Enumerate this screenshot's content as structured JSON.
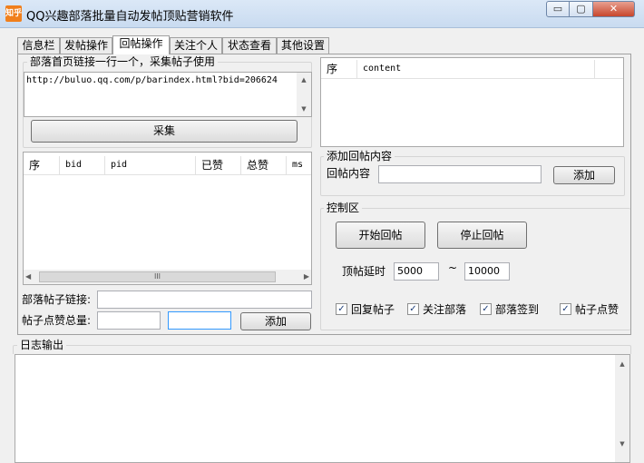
{
  "window": {
    "title": "QQ兴趣部落批量自动发帖顶贴营销软件",
    "icon_text": "知乎",
    "min_glyph": "▭",
    "max_glyph": "▢",
    "close_glyph": "✕"
  },
  "tabs": [
    {
      "label": "信息栏",
      "active": false
    },
    {
      "label": "发帖操作",
      "active": false
    },
    {
      "label": "回帖操作",
      "active": true
    },
    {
      "label": "关注个人",
      "active": false
    },
    {
      "label": "状态查看",
      "active": false
    },
    {
      "label": "其他设置",
      "active": false
    }
  ],
  "collect": {
    "group_label": "部落首页链接一行一个，采集帖子使用",
    "url_text": "http://buluo.qq.com/p/barindex.html?bid=206624",
    "button_label": "采集"
  },
  "posts_table": {
    "columns": [
      "序",
      "bid",
      "pid",
      "已赞",
      "总赞",
      "ms"
    ],
    "hscroll_thumb": "III"
  },
  "post_link": {
    "label": "部落帖子链接:",
    "value": ""
  },
  "likes": {
    "label": "帖子点赞总量:",
    "value1": "",
    "value2": "",
    "add_label": "添加"
  },
  "content_table": {
    "columns": [
      "序",
      "content"
    ]
  },
  "reply_content": {
    "group_label": "添加回帖内容",
    "label": "回帖内容",
    "value": "",
    "add_label": "添加"
  },
  "control": {
    "group_label": "控制区",
    "start_label": "开始回帖",
    "stop_label": "停止回帖",
    "delay_label": "顶帖延时",
    "delay_min": "5000",
    "delay_sep": "~",
    "delay_max": "10000",
    "checkboxes": [
      {
        "label": "回复帖子",
        "checked": true
      },
      {
        "label": "关注部落",
        "checked": true
      },
      {
        "label": "部落签到",
        "checked": true
      },
      {
        "label": "帖子点赞",
        "checked": true
      }
    ]
  },
  "log": {
    "label": "日志输出",
    "text": ""
  }
}
